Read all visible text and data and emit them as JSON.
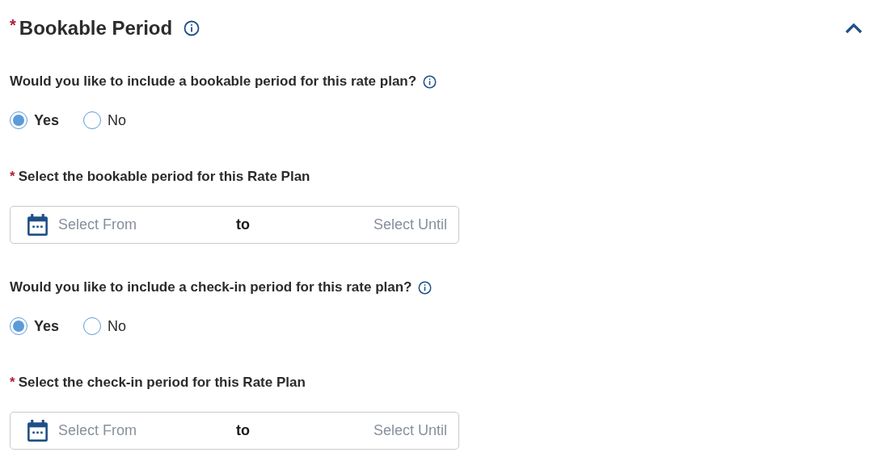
{
  "section": {
    "title": "Bookable Period",
    "required_mark": "*",
    "expanded": true
  },
  "blocks": [
    {
      "kind": "question",
      "text": "Would you like to include a bookable period for this rate plan?",
      "options": [
        {
          "label": "Yes",
          "selected": true
        },
        {
          "label": "No",
          "selected": false
        }
      ]
    },
    {
      "kind": "range",
      "label": "Select the bookable period for this Rate Plan",
      "required_mark": "*",
      "from_placeholder": "Select From",
      "separator": "to",
      "until_placeholder": "Select Until"
    },
    {
      "kind": "question",
      "text": "Would you like to include a check-in period for this rate plan?",
      "options": [
        {
          "label": "Yes",
          "selected": true
        },
        {
          "label": "No",
          "selected": false
        }
      ]
    },
    {
      "kind": "range",
      "label": "Select the check-in period for this Rate Plan",
      "required_mark": "*",
      "from_placeholder": "Select From",
      "separator": "to",
      "until_placeholder": "Select Until"
    }
  ]
}
